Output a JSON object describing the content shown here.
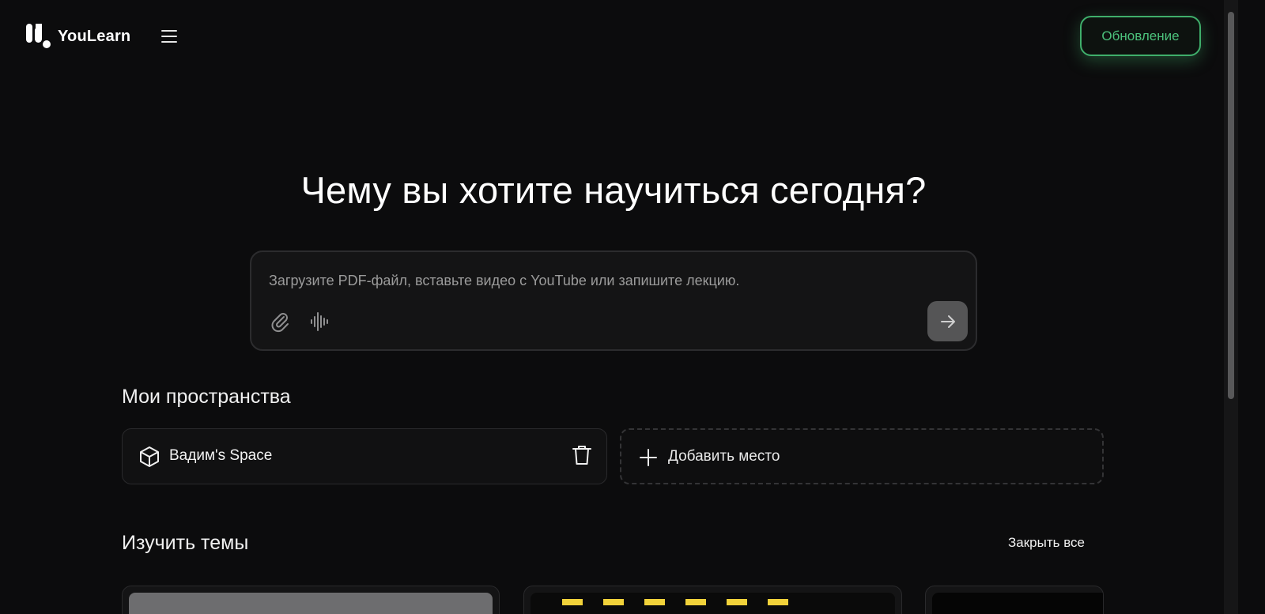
{
  "header": {
    "brand": "YouLearn",
    "upgrade_label": "Обновление"
  },
  "hero": {
    "title": "Чему вы хотите научиться сегодня?",
    "input_placeholder": "Загрузите PDF-файл, вставьте видео с YouTube или запишите лекцию.",
    "input_value": ""
  },
  "spaces": {
    "title": "Мои пространства",
    "items": [
      {
        "name": "Вадим's Space"
      }
    ],
    "add_label": "Добавить место"
  },
  "topics": {
    "title": "Изучить темы",
    "close_all_label": "Закрыть все"
  },
  "icons": {
    "logo": "youlearn-logo-icon",
    "menu": "hamburger-menu-icon",
    "attach": "paperclip-icon",
    "voice": "audio-waveform-icon",
    "send": "arrow-right-icon",
    "space": "cube-icon",
    "delete": "trash-icon",
    "add": "plus-icon"
  },
  "colors": {
    "background": "#0c0c0d",
    "accent_green": "#3fae6b",
    "card_border": "#2a2a2c",
    "send_button": "#555556"
  }
}
